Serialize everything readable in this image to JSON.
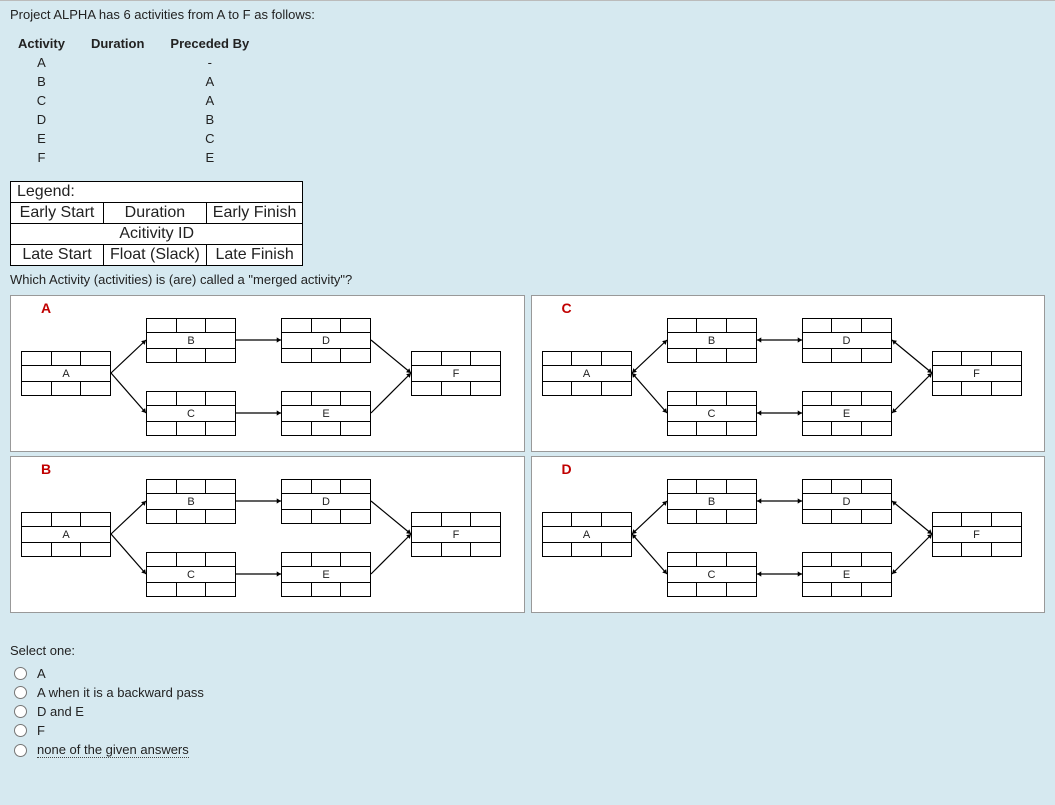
{
  "intro": "Project ALPHA has 6 activities from A to F as follows:",
  "table_headers": {
    "activity": "Activity",
    "duration": "Duration",
    "preceded": "Preceded By"
  },
  "activities": [
    {
      "id": "A",
      "preceded": "-"
    },
    {
      "id": "B",
      "preceded": "A"
    },
    {
      "id": "C",
      "preceded": "A"
    },
    {
      "id": "D",
      "preceded": "B"
    },
    {
      "id": "E",
      "preceded": "C"
    },
    {
      "id": "F",
      "preceded": "E"
    }
  ],
  "legend": {
    "title": "Legend:",
    "r1c1": "Early Start",
    "r1c2": "Duration",
    "r1c3": "Early Finish",
    "r2": "Acitivity ID",
    "r3c1": "Late Start",
    "r3c2": "Float (Slack)",
    "r3c3": "Late Finish"
  },
  "question": "Which Activity (activities) is (are) called a \"merged  activity\"?",
  "panels": {
    "A": "A",
    "B": "B",
    "C": "C",
    "D": "D"
  },
  "nodes": {
    "A": "A",
    "B": "B",
    "C": "C",
    "D": "D",
    "E": "E",
    "F": "F"
  },
  "answers": {
    "prompt": "Select one:",
    "opts": [
      "A",
      "A when it is a backward pass",
      "D and E",
      "F",
      "none of the given answers"
    ]
  }
}
